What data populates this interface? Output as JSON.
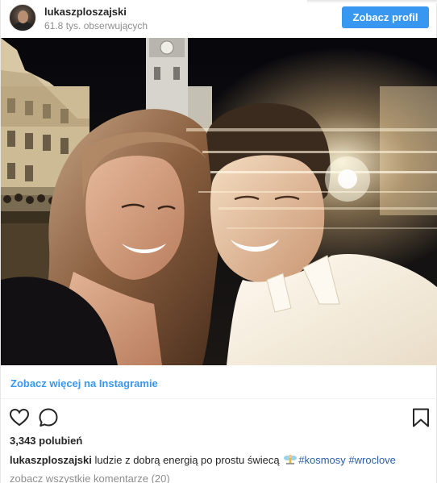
{
  "header": {
    "username": "lukaszploszajski",
    "followers": "61.8 tys. obserwujących",
    "profile_button": "Zobacz profil"
  },
  "post": {
    "view_more": "Zobacz więcej na Instagramie",
    "likes": "3,343 polubień",
    "caption_user": "lukaszploszajski",
    "caption_text": "ludzie z dobrą energią po prostu świecą",
    "hashtag_1": "#kosmosy",
    "hashtag_2": "#wroclove",
    "comments_link": "zobacz wszystkie komentarze (20)"
  },
  "icons": {
    "like": "heart-icon",
    "comment": "comment-bubble-icon",
    "save": "bookmark-icon",
    "emoji": "fairy-emoji"
  },
  "colors": {
    "accent": "#3897f0",
    "text": "#262626",
    "muted": "#8e8e8e",
    "hashtag": "#2b5ea8"
  }
}
